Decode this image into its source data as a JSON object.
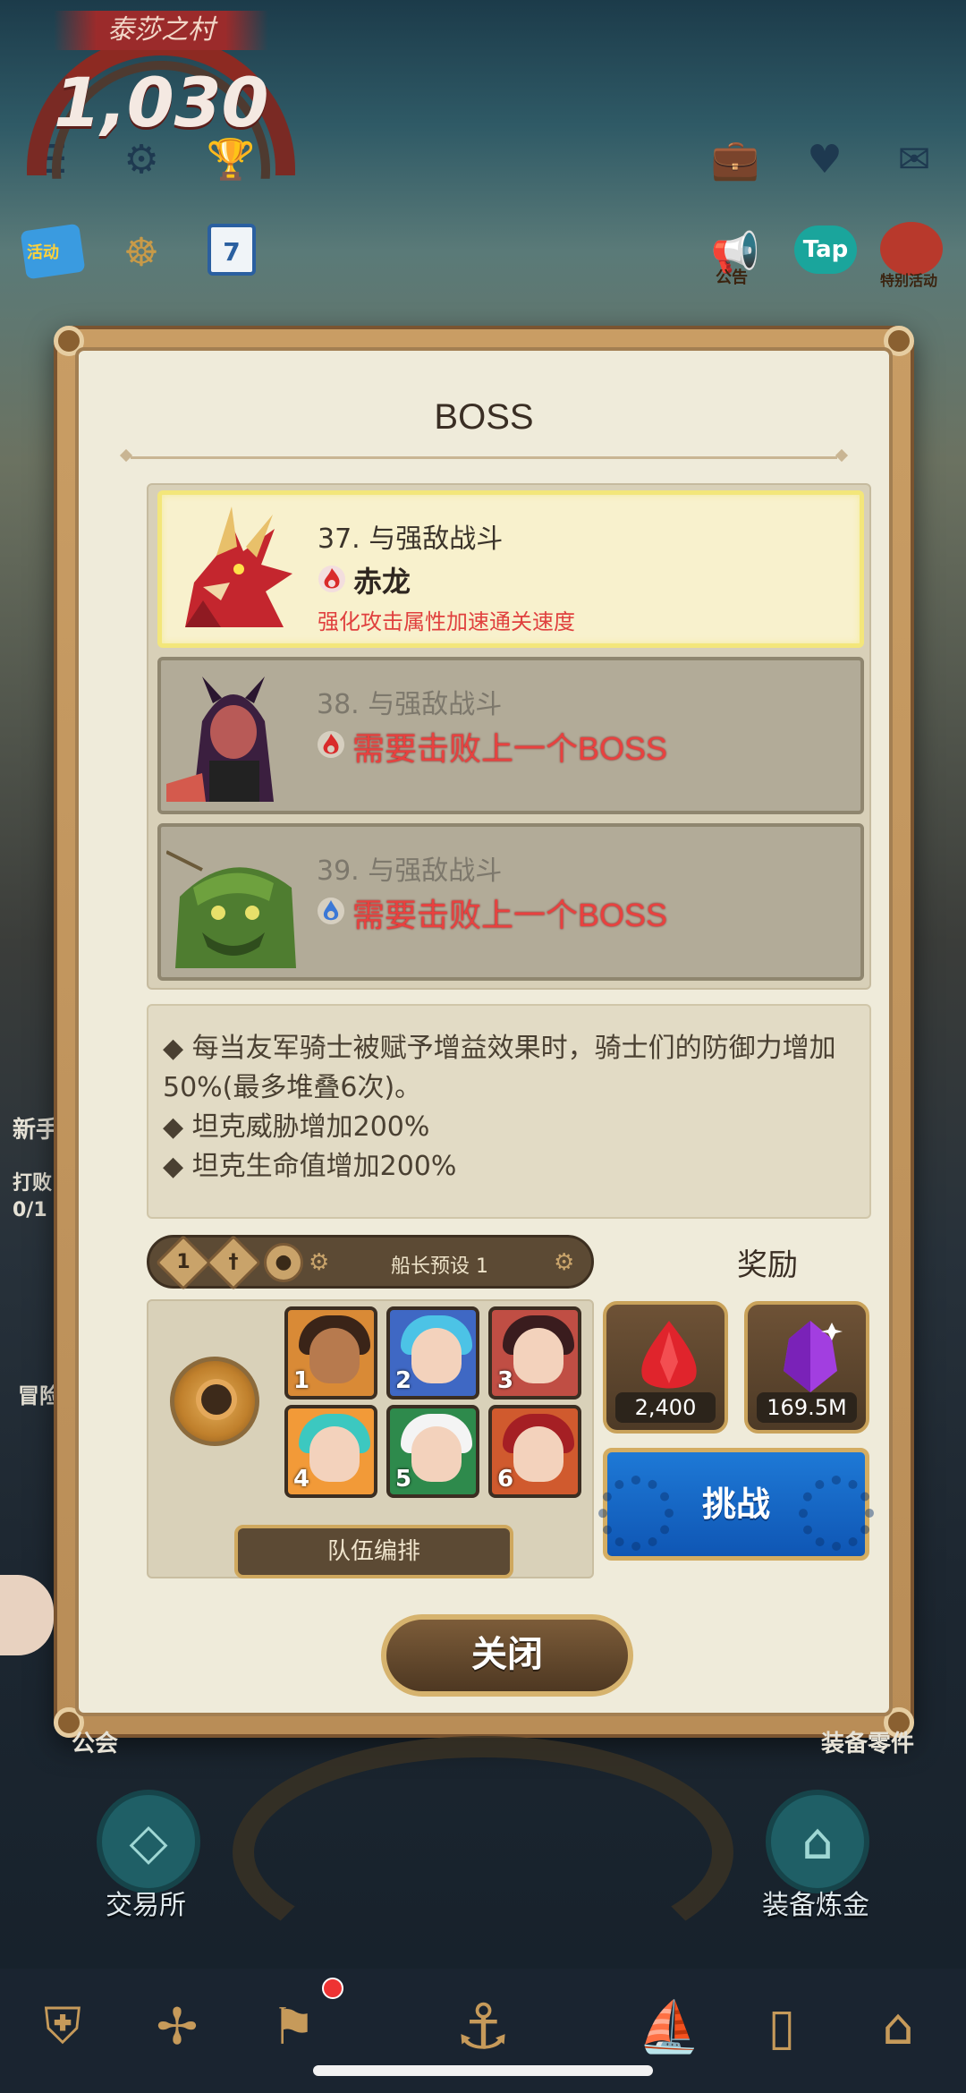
{
  "hud": {
    "village_name": "泰莎之村",
    "score": "1,030",
    "activity_label": "活动",
    "calendar_day": "7",
    "notice_label": "公告",
    "tap_label": "Tap",
    "top_right_label": "特别活动",
    "top_icons": [
      "menu-icon",
      "gear-icon",
      "trophy-icon",
      "briefcase-icon",
      "friends-icon",
      "mail-icon"
    ]
  },
  "modal": {
    "title": "BOSS",
    "bosses": [
      {
        "number_title": "37. 与强敌战斗",
        "name": "赤龙",
        "desc": "强化攻击属性加速通关速度",
        "element": "fire",
        "state": "active"
      },
      {
        "number_title": "38. 与强敌战斗",
        "requirement": "需要击败上一个BOSS",
        "element": "fire",
        "state": "locked"
      },
      {
        "number_title": "39. 与强敌战斗",
        "requirement": "需要击败上一个BOSS",
        "element": "water",
        "state": "locked"
      }
    ],
    "effects": [
      "◆ 每当友军骑士被赋予增益效果时，骑士们的防御力增加50%(最多堆叠6次)。",
      "◆ 坦克威胁增加200%",
      "◆ 坦克生命值增加200%"
    ],
    "preset": {
      "level": "1",
      "label": "船长预设 1"
    },
    "team": {
      "slots": [
        "1",
        "2",
        "3",
        "4",
        "5",
        "6"
      ],
      "button": "队伍编排"
    },
    "reward_title": "奖励",
    "rewards": [
      {
        "item": "red-gem",
        "value": "2,400"
      },
      {
        "item": "purple-crystal",
        "value": "169.5M"
      }
    ],
    "challenge_label": "挑战",
    "close_label": "关闭"
  },
  "background": {
    "left_labels": [
      "新手",
      "打败",
      "0/1",
      "冒险"
    ],
    "guild_label": "公会",
    "right_partial": "装备零件",
    "exchange_label": "交易所",
    "alchemy_label": "装备炼金",
    "dock": [
      "guild-shield-icon",
      "fan-icon",
      "quest-icon",
      "anchor-icon",
      "ship-icon",
      "door-icon",
      "shop-icon"
    ]
  },
  "colors": {
    "accent_red": "#e8413f",
    "challenge_blue": "#1e79d6",
    "frame_gold": "#c9a25a"
  }
}
